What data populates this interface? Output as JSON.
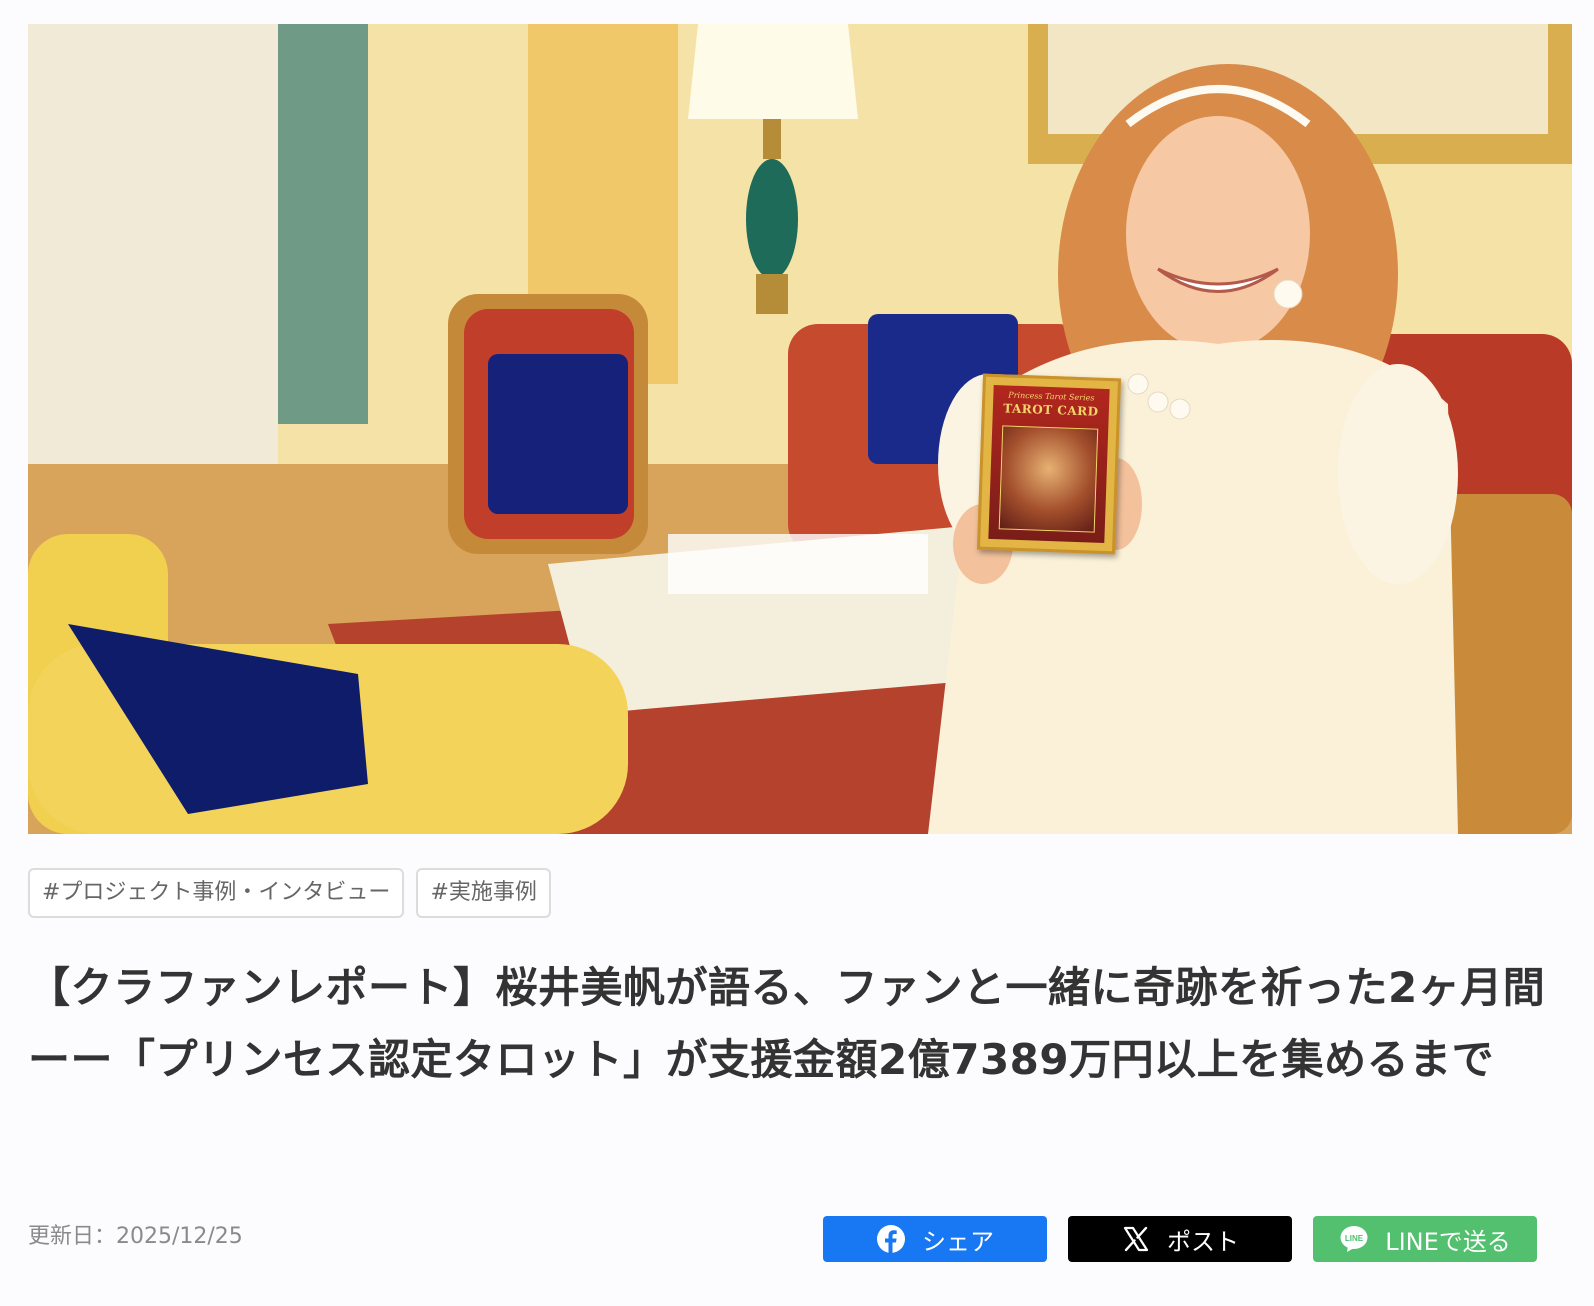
{
  "hero": {
    "tarot_box": {
      "series": "Princess Tarot Series",
      "title": "TAROT CARD"
    }
  },
  "tags": [
    "#プロジェクト事例・インタビュー",
    "#実施事例"
  ],
  "article": {
    "title": "【クラファンレポート】桜井美帆が語る、ファンと一緒に奇跡を祈った2ヶ月間ーー「プリンセス認定タロット」が支援金額2億7389万円以上を集めるまで",
    "updated": "更新日：2025/12/25"
  },
  "share": {
    "facebook": {
      "label": "シェア",
      "icon": "facebook-icon",
      "color": "#1877f2"
    },
    "x": {
      "label": "ポスト",
      "icon": "x-logo-icon",
      "color": "#000000"
    },
    "line": {
      "label": "LINEで送る",
      "icon": "line-icon",
      "color": "#52c06f"
    }
  }
}
